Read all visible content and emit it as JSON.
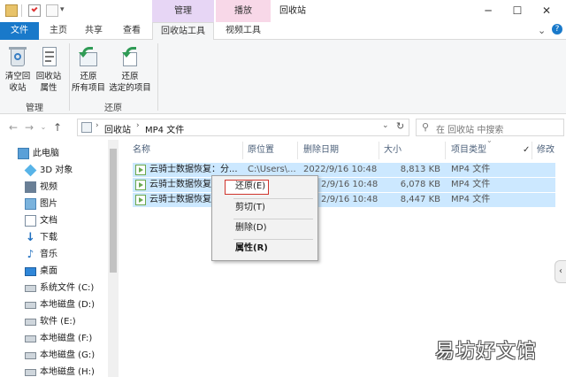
{
  "window": {
    "title": "回收站",
    "context_tab_manage": "管理",
    "context_tab_play": "播放",
    "minimize": "─",
    "maximize": "☐",
    "close": "✕",
    "collapse": "⌄",
    "help": "?"
  },
  "ribbon_tabs": {
    "file": "文件",
    "home": "主页",
    "share": "共享",
    "view": "查看",
    "recycle_tools": "回收站工具",
    "video_tools": "视频工具"
  },
  "ribbon": {
    "empty_bin": "清空回\n收站",
    "bin_props": "回收站\n属性",
    "group_manage": "管理",
    "restore_all": "还原\n所有项目",
    "restore_selected": "还原\n选定的项目",
    "group_restore": "还原"
  },
  "address": {
    "crumb_root": "回收站",
    "crumb_folder": "MP4 文件",
    "search_placeholder": "在 回收站 中搜索"
  },
  "sidebar": {
    "items": [
      {
        "label": "此电脑",
        "icon": "computer-icon"
      },
      {
        "label": "3D 对象",
        "icon": "cube-icon"
      },
      {
        "label": "视频",
        "icon": "video-folder-icon"
      },
      {
        "label": "图片",
        "icon": "pictures-folder-icon"
      },
      {
        "label": "文档",
        "icon": "documents-folder-icon"
      },
      {
        "label": "下载",
        "icon": "download-arrow-icon"
      },
      {
        "label": "音乐",
        "icon": "music-note-icon"
      },
      {
        "label": "桌面",
        "icon": "desktop-icon"
      },
      {
        "label": "系统文件 (C:)",
        "icon": "drive-icon"
      },
      {
        "label": "本地磁盘 (D:)",
        "icon": "drive-icon"
      },
      {
        "label": "软件 (E:)",
        "icon": "drive-icon"
      },
      {
        "label": "本地磁盘 (F:)",
        "icon": "drive-icon"
      },
      {
        "label": "本地磁盘 (G:)",
        "icon": "drive-icon"
      },
      {
        "label": "本地磁盘 (H:)",
        "icon": "drive-icon"
      }
    ]
  },
  "columns": {
    "name": "名称",
    "orig": "原位置",
    "deleted": "删除日期",
    "size": "大小",
    "type": "项目类型",
    "modified": "修改"
  },
  "rows": [
    {
      "name": "云骑士数据恢复：分...",
      "orig": "C:\\Users\\...",
      "deleted": "2022/9/16 10:48",
      "size": "8,813 KB",
      "type": "MP4 文件"
    },
    {
      "name": "云骑士数据恢复：",
      "orig": "",
      "deleted": "2/9/16 10:48",
      "size": "6,078 KB",
      "type": "MP4 文件"
    },
    {
      "name": "云骑士数据恢复：",
      "orig": "",
      "deleted": "2/9/16 10:48",
      "size": "8,447 KB",
      "type": "MP4 文件"
    }
  ],
  "context_menu": {
    "restore": "还原(E)",
    "cut": "剪切(T)",
    "delete": "删除(D)",
    "properties": "属性(R)"
  },
  "watermark": "易坊好文馆",
  "colors": {
    "file_tab": "#1979ca",
    "manage_tab": "#e7d6f5",
    "play_tab": "#f8d8e8",
    "selection": "#cce8ff",
    "restore_highlight_border": "#c0392b"
  }
}
